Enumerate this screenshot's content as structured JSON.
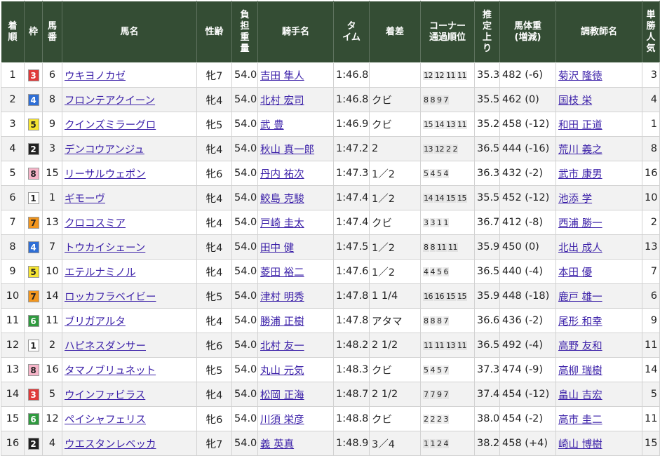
{
  "headers": {
    "rank": [
      "着",
      "順"
    ],
    "waku": [
      "枠"
    ],
    "umaban": [
      "馬",
      "番"
    ],
    "horse": [
      "馬名"
    ],
    "sexage": [
      "性齢"
    ],
    "weight": [
      "負",
      "担",
      "重",
      "量"
    ],
    "jockey": [
      "騎手名"
    ],
    "time": [
      "タ",
      "イム"
    ],
    "margin": [
      "着差"
    ],
    "corner": [
      "コーナー",
      "通過順位"
    ],
    "last": [
      "推",
      "定",
      "上",
      "り"
    ],
    "bodyweight": [
      "馬体重",
      "(増減)"
    ],
    "trainer": [
      "調教師名"
    ],
    "pop": [
      "単",
      "勝",
      "人",
      "気"
    ]
  },
  "waku_colors": {
    "1": {
      "bg": "#ffffff",
      "fg": "#222222"
    },
    "2": {
      "bg": "#222222",
      "fg": "#ffffff"
    },
    "3": {
      "bg": "#e03a3a",
      "fg": "#ffffff"
    },
    "4": {
      "bg": "#2f6fd6",
      "fg": "#ffffff"
    },
    "5": {
      "bg": "#f5e431",
      "fg": "#222222"
    },
    "6": {
      "bg": "#2f9a3f",
      "fg": "#ffffff"
    },
    "7": {
      "bg": "#f2961e",
      "fg": "#222222"
    },
    "8": {
      "bg": "#f6b4c8",
      "fg": "#222222"
    }
  },
  "rows": [
    {
      "rank": "1",
      "waku": "3",
      "umaban": "6",
      "horse": "ウキヨノカゼ",
      "sexage": "牝7",
      "weight": "54.0",
      "jockey": "吉田 隼人",
      "time": "1:46.8",
      "margin": "",
      "corner": [
        "12",
        "12",
        "11",
        "11"
      ],
      "last": "35.3",
      "bodyweight": "482 (-6)",
      "trainer": "菊沢 隆徳",
      "pop": "3"
    },
    {
      "rank": "2",
      "waku": "4",
      "umaban": "8",
      "horse": "フロンテアクイーン",
      "sexage": "牝4",
      "weight": "54.0",
      "jockey": "北村 宏司",
      "time": "1:46.8",
      "margin": "クビ",
      "corner": [
        "8",
        "8",
        "9",
        "7"
      ],
      "last": "35.5",
      "bodyweight": "462 (0)",
      "trainer": "国枝 栄",
      "pop": "4"
    },
    {
      "rank": "3",
      "waku": "5",
      "umaban": "9",
      "horse": "クインズミラーグロ",
      "sexage": "牝5",
      "weight": "54.0",
      "jockey": "武 豊",
      "time": "1:46.9",
      "margin": "クビ",
      "corner": [
        "15",
        "14",
        "13",
        "11"
      ],
      "last": "35.2",
      "bodyweight": "458 (-12)",
      "trainer": "和田 正道",
      "pop": "1"
    },
    {
      "rank": "4",
      "waku": "2",
      "umaban": "3",
      "horse": "デンコウアンジュ",
      "sexage": "牝4",
      "weight": "54.0",
      "jockey": "秋山 真一郎",
      "time": "1:47.2",
      "margin": "2",
      "corner": [
        "13",
        "12",
        "2",
        "2"
      ],
      "last": "36.5",
      "bodyweight": "444 (-16)",
      "trainer": "荒川 義之",
      "pop": "8"
    },
    {
      "rank": "5",
      "waku": "8",
      "umaban": "15",
      "horse": "リーサルウェポン",
      "sexage": "牝6",
      "weight": "54.0",
      "jockey": "丹内 祐次",
      "time": "1:47.3",
      "margin": "1／2",
      "corner": [
        "5",
        "4",
        "5",
        "4"
      ],
      "last": "36.3",
      "bodyweight": "432 (-2)",
      "trainer": "武市 康男",
      "pop": "16"
    },
    {
      "rank": "6",
      "waku": "1",
      "umaban": "1",
      "horse": "ギモーヴ",
      "sexage": "牝4",
      "weight": "54.0",
      "jockey": "鮫島 克駿",
      "time": "1:47.4",
      "margin": "1／2",
      "corner": [
        "14",
        "14",
        "15",
        "15"
      ],
      "last": "35.5",
      "bodyweight": "452 (-12)",
      "trainer": "池添 学",
      "pop": "10"
    },
    {
      "rank": "7",
      "waku": "7",
      "umaban": "13",
      "horse": "クロコスミア",
      "sexage": "牝4",
      "weight": "54.0",
      "jockey": "戸崎 圭太",
      "time": "1:47.4",
      "margin": "クビ",
      "corner": [
        "3",
        "3",
        "1",
        "1"
      ],
      "last": "36.7",
      "bodyweight": "412 (-8)",
      "trainer": "西浦 勝一",
      "pop": "2"
    },
    {
      "rank": "8",
      "waku": "4",
      "umaban": "7",
      "horse": "トウカイシェーン",
      "sexage": "牝4",
      "weight": "54.0",
      "jockey": "田中 健",
      "time": "1:47.5",
      "margin": "1／2",
      "corner": [
        "8",
        "8",
        "11",
        "11"
      ],
      "last": "35.9",
      "bodyweight": "450 (0)",
      "trainer": "北出 成人",
      "pop": "13"
    },
    {
      "rank": "9",
      "waku": "5",
      "umaban": "10",
      "horse": "エテルナミノル",
      "sexage": "牝4",
      "weight": "54.0",
      "jockey": "菱田 裕二",
      "time": "1:47.6",
      "margin": "1／2",
      "corner": [
        "4",
        "4",
        "5",
        "6"
      ],
      "last": "36.5",
      "bodyweight": "440 (-4)",
      "trainer": "本田 優",
      "pop": "7"
    },
    {
      "rank": "10",
      "waku": "7",
      "umaban": "14",
      "horse": "ロッカフラベイビー",
      "sexage": "牝5",
      "weight": "54.0",
      "jockey": "津村 明秀",
      "time": "1:47.8",
      "margin": "1 1/4",
      "corner": [
        "16",
        "16",
        "15",
        "15"
      ],
      "last": "35.9",
      "bodyweight": "448 (-18)",
      "trainer": "鹿戸 雄一",
      "pop": "6"
    },
    {
      "rank": "11",
      "waku": "6",
      "umaban": "11",
      "horse": "ブリガアルタ",
      "sexage": "牝4",
      "weight": "54.0",
      "jockey": "勝浦 正樹",
      "time": "1:47.8",
      "margin": "アタマ",
      "corner": [
        "8",
        "8",
        "8",
        "7"
      ],
      "last": "36.6",
      "bodyweight": "436 (-2)",
      "trainer": "尾形 和幸",
      "pop": "9"
    },
    {
      "rank": "12",
      "waku": "1",
      "umaban": "2",
      "horse": "ハピネスダンサー",
      "sexage": "牝6",
      "weight": "54.0",
      "jockey": "北村 友一",
      "time": "1:48.2",
      "margin": "2 1/2",
      "corner": [
        "11",
        "11",
        "13",
        "11"
      ],
      "last": "36.5",
      "bodyweight": "492 (-4)",
      "trainer": "高野 友和",
      "pop": "11"
    },
    {
      "rank": "13",
      "waku": "8",
      "umaban": "16",
      "horse": "タマノブリュネット",
      "sexage": "牝5",
      "weight": "54.0",
      "jockey": "丸山 元気",
      "time": "1:48.3",
      "margin": "クビ",
      "corner": [
        "5",
        "4",
        "5",
        "7"
      ],
      "last": "37.3",
      "bodyweight": "474 (-9)",
      "trainer": "高柳 瑞樹",
      "pop": "14"
    },
    {
      "rank": "14",
      "waku": "3",
      "umaban": "5",
      "horse": "ウインファビラス",
      "sexage": "牝4",
      "weight": "54.0",
      "jockey": "松岡 正海",
      "time": "1:48.7",
      "margin": "2 1/2",
      "corner": [
        "7",
        "7",
        "9",
        "7"
      ],
      "last": "37.4",
      "bodyweight": "454 (-12)",
      "trainer": "畠山 吉宏",
      "pop": "5"
    },
    {
      "rank": "15",
      "waku": "6",
      "umaban": "12",
      "horse": "ペイシャフェリス",
      "sexage": "牝6",
      "weight": "54.0",
      "jockey": "川須 栄彦",
      "time": "1:48.8",
      "margin": "クビ",
      "corner": [
        "2",
        "2",
        "2",
        "3"
      ],
      "last": "38.0",
      "bodyweight": "454 (-2)",
      "trainer": "高市 圭二",
      "pop": "11"
    },
    {
      "rank": "16",
      "waku": "2",
      "umaban": "4",
      "horse": "ウエスタンレベッカ",
      "sexage": "牝7",
      "weight": "54.0",
      "jockey": "義 英真",
      "time": "1:48.9",
      "margin": "3／4",
      "corner": [
        "1",
        "1",
        "2",
        "4"
      ],
      "last": "38.2",
      "bodyweight": "458 (+4)",
      "trainer": "崎山 博樹",
      "pop": "15"
    }
  ]
}
